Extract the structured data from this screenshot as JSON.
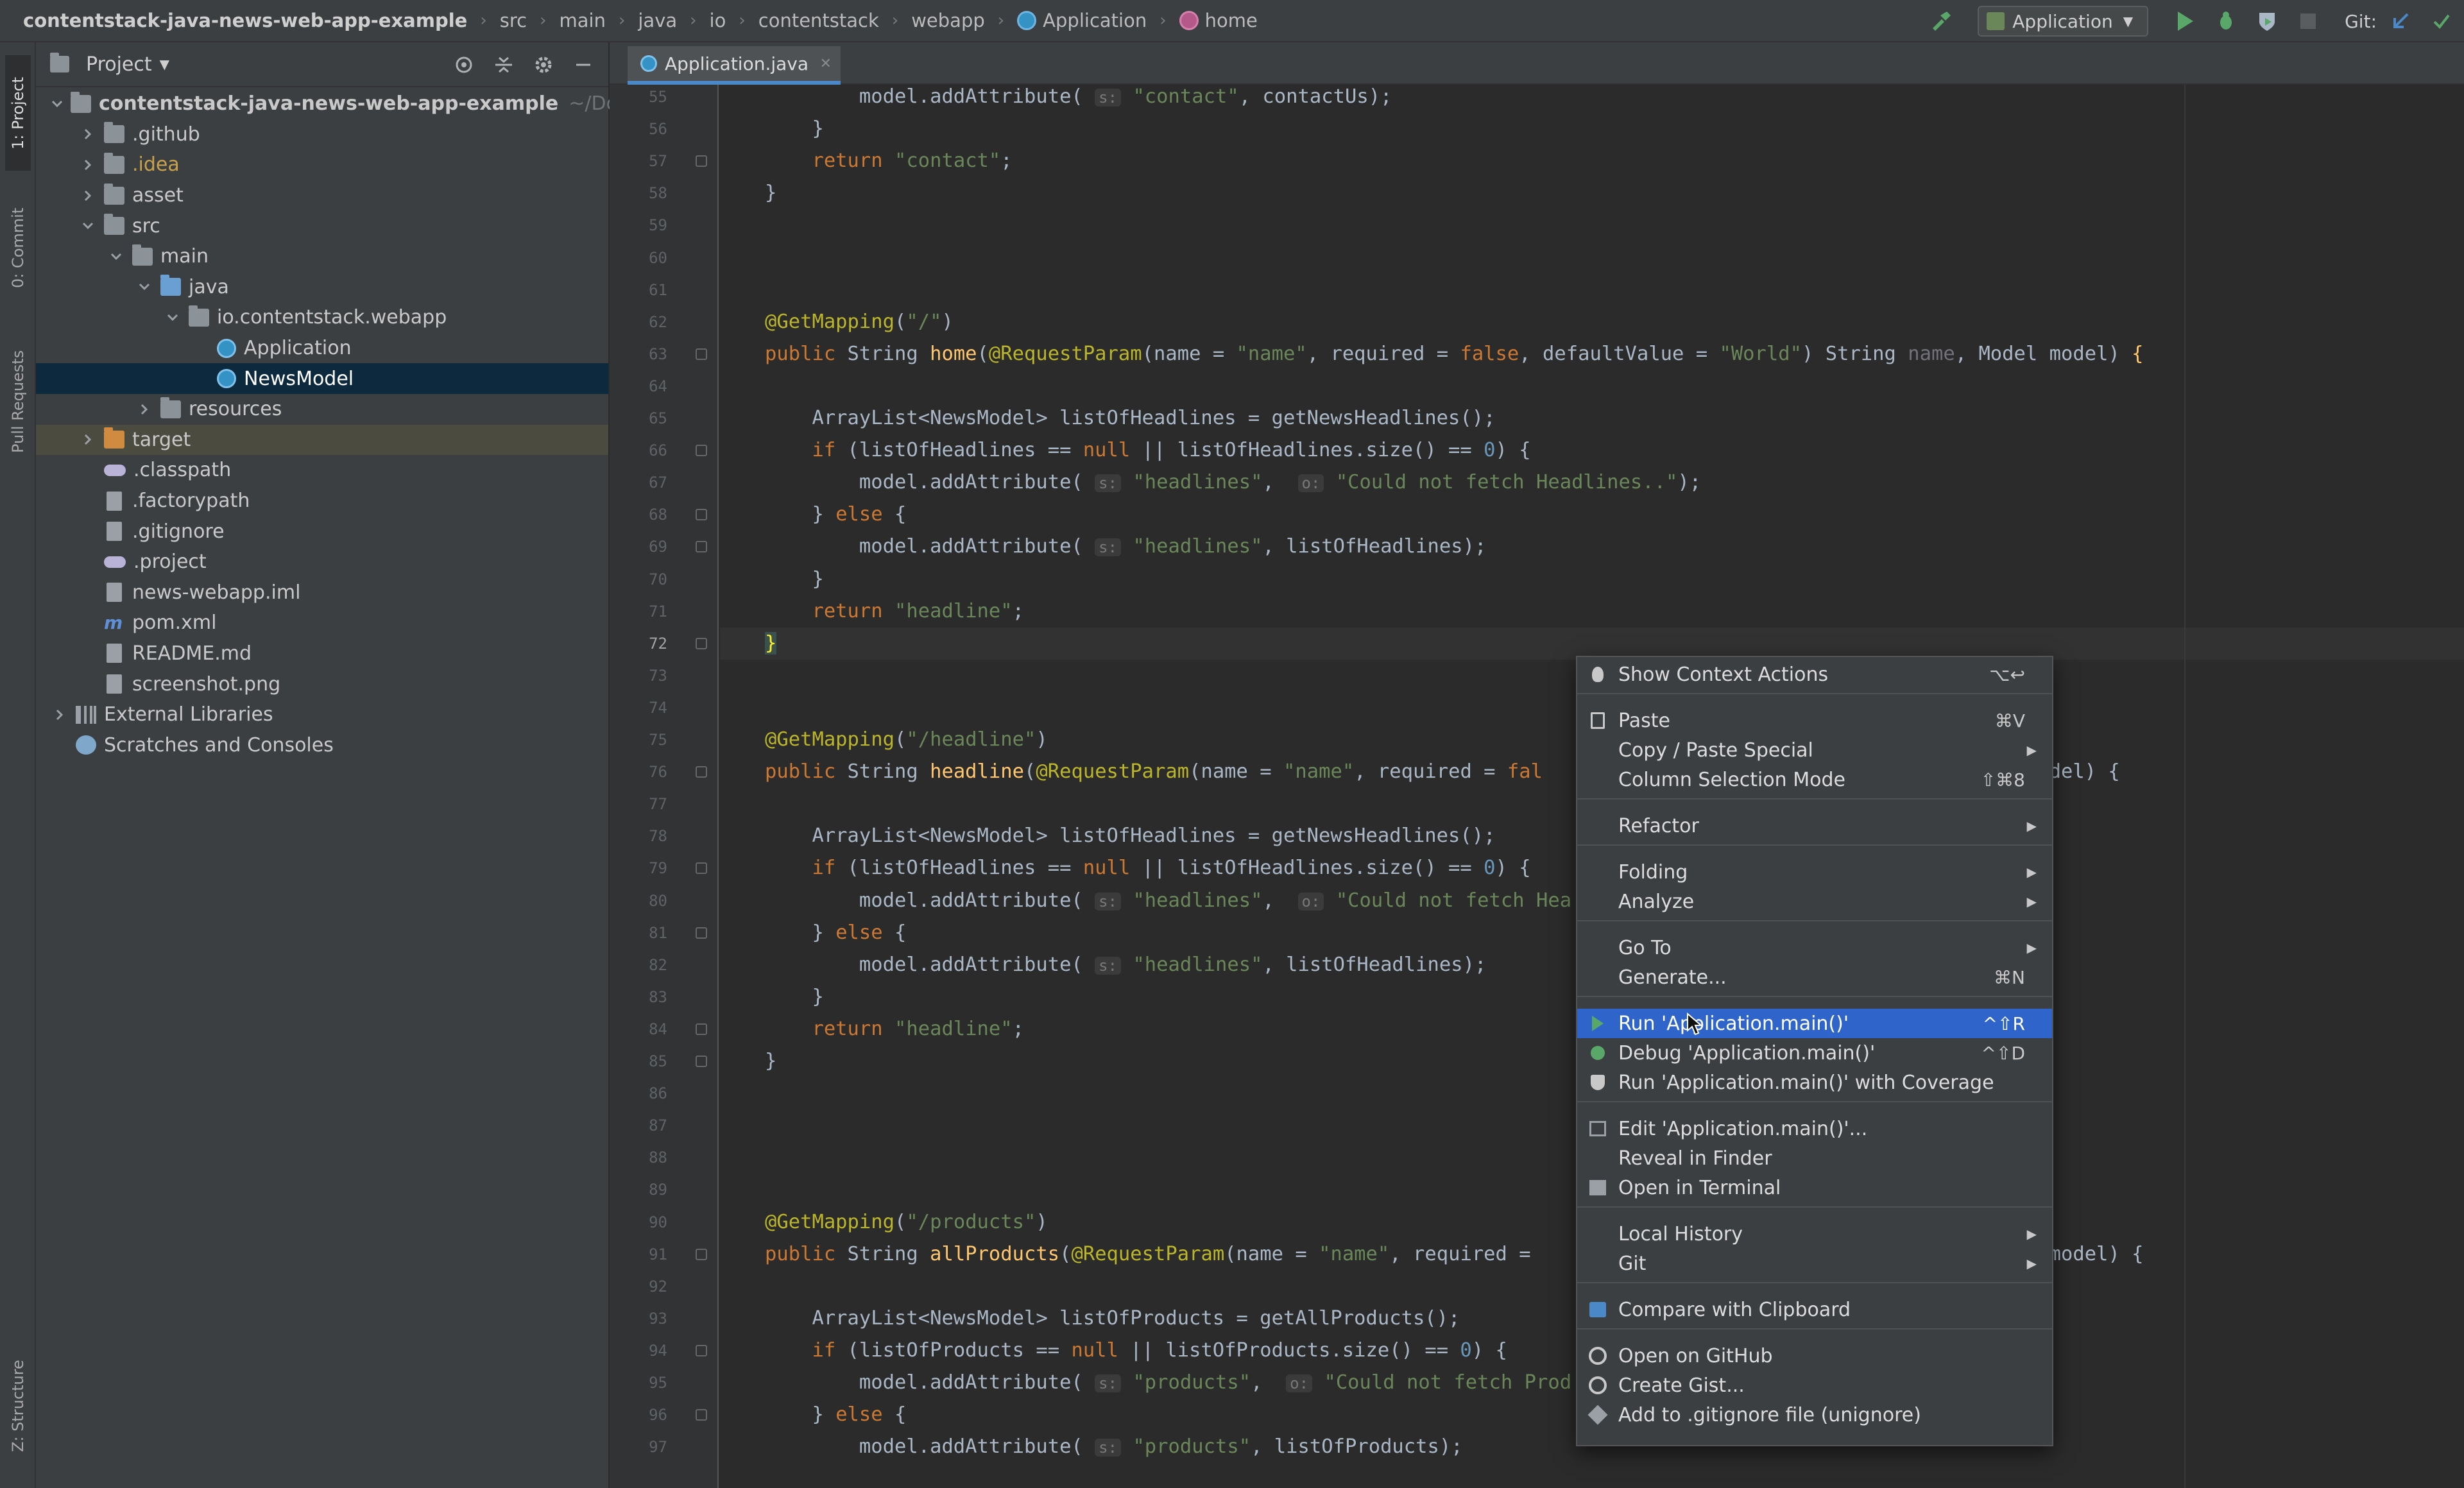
{
  "breadcrumbs": [
    "contentstack-java-news-web-app-example",
    "src",
    "main",
    "java",
    "io",
    "contentstack",
    "webapp",
    "Application",
    "home"
  ],
  "toolbar": {
    "run_config": "Application",
    "git_label": "Git:"
  },
  "left_stripe": {
    "project": "1: Project",
    "commit": "0: Commit",
    "pull_requests": "Pull Requests",
    "structure": "Z: Structure"
  },
  "project_panel": {
    "title": "Project",
    "tree": [
      {
        "label": "contentstack-java-news-web-app-example",
        "hint": "~/Do",
        "depth": 0,
        "expanded": true,
        "icon": "folder",
        "bold": true
      },
      {
        "label": ".github",
        "depth": 1,
        "expanded": false,
        "icon": "folder"
      },
      {
        "label": ".idea",
        "depth": 1,
        "expanded": false,
        "icon": "folder",
        "style": "idea"
      },
      {
        "label": "asset",
        "depth": 1,
        "expanded": false,
        "icon": "folder"
      },
      {
        "label": "src",
        "depth": 1,
        "expanded": true,
        "icon": "folder"
      },
      {
        "label": "main",
        "depth": 2,
        "expanded": true,
        "icon": "folder"
      },
      {
        "label": "java",
        "depth": 3,
        "expanded": true,
        "icon": "folder-blue"
      },
      {
        "label": "io.contentstack.webapp",
        "depth": 4,
        "expanded": true,
        "icon": "folder"
      },
      {
        "label": "Application",
        "depth": 5,
        "icon": "class"
      },
      {
        "label": "NewsModel",
        "depth": 5,
        "icon": "class",
        "selected": true
      },
      {
        "label": "resources",
        "depth": 3,
        "expanded": false,
        "icon": "folder"
      },
      {
        "label": "target",
        "depth": 1,
        "expanded": false,
        "icon": "folder-orange",
        "hover": true
      },
      {
        "label": ".classpath",
        "depth": 1,
        "icon": "oval"
      },
      {
        "label": ".factorypath",
        "depth": 1,
        "icon": "file"
      },
      {
        "label": ".gitignore",
        "depth": 1,
        "icon": "file"
      },
      {
        "label": ".project",
        "depth": 1,
        "icon": "oval"
      },
      {
        "label": "news-webapp.iml",
        "depth": 1,
        "icon": "file"
      },
      {
        "label": "pom.xml",
        "depth": 1,
        "icon": "maven"
      },
      {
        "label": "README.md",
        "depth": 1,
        "icon": "file"
      },
      {
        "label": "screenshot.png",
        "depth": 1,
        "icon": "file"
      },
      {
        "label": "External Libraries",
        "depth": 0,
        "expanded": false,
        "icon": "library"
      },
      {
        "label": "Scratches and Consoles",
        "depth": 0,
        "icon": "scratch"
      }
    ]
  },
  "editor": {
    "tab": "Application.java",
    "current_line": "72",
    "lines": [
      {
        "n": "55",
        "h": "        model.addAttribute( <span class=\"hint-chip\">s:</span> <span class=\"str\">\"contact\"</span>, contactUs);"
      },
      {
        "n": "56",
        "h": "    }"
      },
      {
        "n": "57",
        "h": "    <span class=\"kw\">return</span> <span class=\"str\">\"contact\"</span>;"
      },
      {
        "n": "58",
        "h": "}"
      },
      {
        "n": "59",
        "h": ""
      },
      {
        "n": "60",
        "h": ""
      },
      {
        "n": "61",
        "h": ""
      },
      {
        "n": "62",
        "h": "<span class=\"ann\">@GetMapping</span>(<span class=\"str\">\"/\"</span>)"
      },
      {
        "n": "63",
        "h": "<span class=\"kw\">public</span> String <span class=\"mth\">home</span>(<span class=\"ann\">@RequestParam</span>(name = <span class=\"str\">\"name\"</span>, required = <span class=\"kw\">false</span>, defaultValue = <span class=\"str\">\"World\"</span>) String <span class=\"par\">name</span>, Model model) <span class=\"mth\">{</span>"
      },
      {
        "n": "64",
        "h": ""
      },
      {
        "n": "65",
        "h": "    ArrayList&lt;NewsModel&gt; listOfHeadlines = getNewsHeadlines();"
      },
      {
        "n": "66",
        "h": "    <span class=\"kw\">if</span> (listOfHeadlines == <span class=\"kw\">null</span> || listOfHeadlines.size() == <span class=\"num\">0</span>) {"
      },
      {
        "n": "67",
        "h": "        model.addAttribute( <span class=\"hint-chip\">s:</span> <span class=\"str\">\"headlines\"</span>,  <span class=\"hint-chip\">o:</span> <span class=\"str\">\"Could not fetch Headlines..\"</span>);"
      },
      {
        "n": "68",
        "h": "    } <span class=\"kw\">else</span> {"
      },
      {
        "n": "69",
        "h": "        model.addAttribute( <span class=\"hint-chip\">s:</span> <span class=\"str\">\"headlines\"</span>, listOfHeadlines);"
      },
      {
        "n": "70",
        "h": "    }"
      },
      {
        "n": "71",
        "h": "    <span class=\"kw\">return</span> <span class=\"str\">\"headline\"</span>;"
      },
      {
        "n": "72",
        "h": "<span class=\"brace-hl\">}</span>"
      },
      {
        "n": "73",
        "h": ""
      },
      {
        "n": "74",
        "h": ""
      },
      {
        "n": "75",
        "h": "<span class=\"ann\">@GetMapping</span>(<span class=\"str\">\"/headline\"</span>)"
      },
      {
        "n": "76",
        "h": "<span class=\"kw\">public</span> String <span class=\"mth\">headline</span>(<span class=\"ann\">@RequestParam</span>(name = <span class=\"str\">\"name\"</span>, required = <span class=\"kw\">fal</span>                                 , Model model) {"
      },
      {
        "n": "77",
        "h": ""
      },
      {
        "n": "78",
        "h": "    ArrayList&lt;NewsModel&gt; listOfHeadlines = getNewsHeadlines();"
      },
      {
        "n": "79",
        "h": "    <span class=\"kw\">if</span> (listOfHeadlines == <span class=\"kw\">null</span> || listOfHeadlines.size() == <span class=\"num\">0</span>) {"
      },
      {
        "n": "80",
        "h": "        model.addAttribute( <span class=\"hint-chip\">s:</span> <span class=\"str\">\"headlines\"</span>,  <span class=\"hint-chip\">o:</span> <span class=\"str\">\"Could not fetch Hea</span>"
      },
      {
        "n": "81",
        "h": "    } <span class=\"kw\">else</span> {"
      },
      {
        "n": "82",
        "h": "        model.addAttribute( <span class=\"hint-chip\">s:</span> <span class=\"str\">\"headlines\"</span>, listOfHeadlines);"
      },
      {
        "n": "83",
        "h": "    }"
      },
      {
        "n": "84",
        "h": "    <span class=\"kw\">return</span> <span class=\"str\">\"headline\"</span>;"
      },
      {
        "n": "85",
        "h": "}"
      },
      {
        "n": "86",
        "h": ""
      },
      {
        "n": "87",
        "h": ""
      },
      {
        "n": "88",
        "h": ""
      },
      {
        "n": "89",
        "h": ""
      },
      {
        "n": "90",
        "h": "<span class=\"ann\">@GetMapping</span>(<span class=\"str\">\"/products\"</span>)"
      },
      {
        "n": "91",
        "h": "<span class=\"kw\">public</span> String <span class=\"mth\">allProducts</span>(<span class=\"ann\">@RequestParam</span>(name = <span class=\"str\">\"name\"</span>, required =                                 <span class=\"par\">ame</span>, Model model) {"
      },
      {
        "n": "92",
        "h": ""
      },
      {
        "n": "93",
        "h": "    ArrayList&lt;NewsModel&gt; listOfProducts = getAllProducts();"
      },
      {
        "n": "94",
        "h": "    <span class=\"kw\">if</span> (listOfProducts == <span class=\"kw\">null</span> || listOfProducts.size() == <span class=\"num\">0</span>) {"
      },
      {
        "n": "95",
        "h": "        model.addAttribute( <span class=\"hint-chip\">s:</span> <span class=\"str\">\"products\"</span>,  <span class=\"hint-chip\">o:</span> <span class=\"str\">\"Could not fetch Prod</span>"
      },
      {
        "n": "96",
        "h": "    } <span class=\"kw\">else</span> {"
      },
      {
        "n": "97",
        "h": "        model.addAttribute( <span class=\"hint-chip\">s:</span> <span class=\"str\">\"products\"</span>, listOfProducts);"
      }
    ]
  },
  "context_menu": {
    "groups": [
      [
        {
          "label": "Show Context Actions",
          "shortcut": "⌥↩",
          "icon": "bulb"
        }
      ],
      [
        {
          "label": "Paste",
          "shortcut": "⌘V",
          "icon": "clipboard"
        },
        {
          "label": "Copy / Paste Special",
          "submenu": true
        },
        {
          "label": "Column Selection Mode",
          "shortcut": "⇧⌘8"
        }
      ],
      [
        {
          "label": "Refactor",
          "submenu": true
        }
      ],
      [
        {
          "label": "Folding",
          "submenu": true
        },
        {
          "label": "Analyze",
          "submenu": true
        }
      ],
      [
        {
          "label": "Go To",
          "submenu": true
        },
        {
          "label": "Generate...",
          "shortcut": "⌘N"
        }
      ],
      [
        {
          "label": "Run 'Application.main()'",
          "shortcut": "^⇧R",
          "icon": "run",
          "highlighted": true
        },
        {
          "label": "Debug 'Application.main()'",
          "shortcut": "^⇧D",
          "icon": "debug"
        },
        {
          "label": "Run 'Application.main()' with Coverage",
          "icon": "coverage"
        }
      ],
      [
        {
          "label": "Edit 'Application.main()'...",
          "icon": "edit-config"
        },
        {
          "label": "Reveal in Finder"
        },
        {
          "label": "Open in Terminal",
          "icon": "terminal"
        }
      ],
      [
        {
          "label": "Local History",
          "submenu": true
        },
        {
          "label": "Git",
          "submenu": true
        }
      ],
      [
        {
          "label": "Compare with Clipboard",
          "icon": "compare"
        }
      ],
      [
        {
          "label": "Open on GitHub",
          "icon": "github"
        },
        {
          "label": "Create Gist...",
          "icon": "github"
        },
        {
          "label": "Add to .gitignore file (unignore)",
          "icon": "gitignore"
        }
      ]
    ]
  }
}
